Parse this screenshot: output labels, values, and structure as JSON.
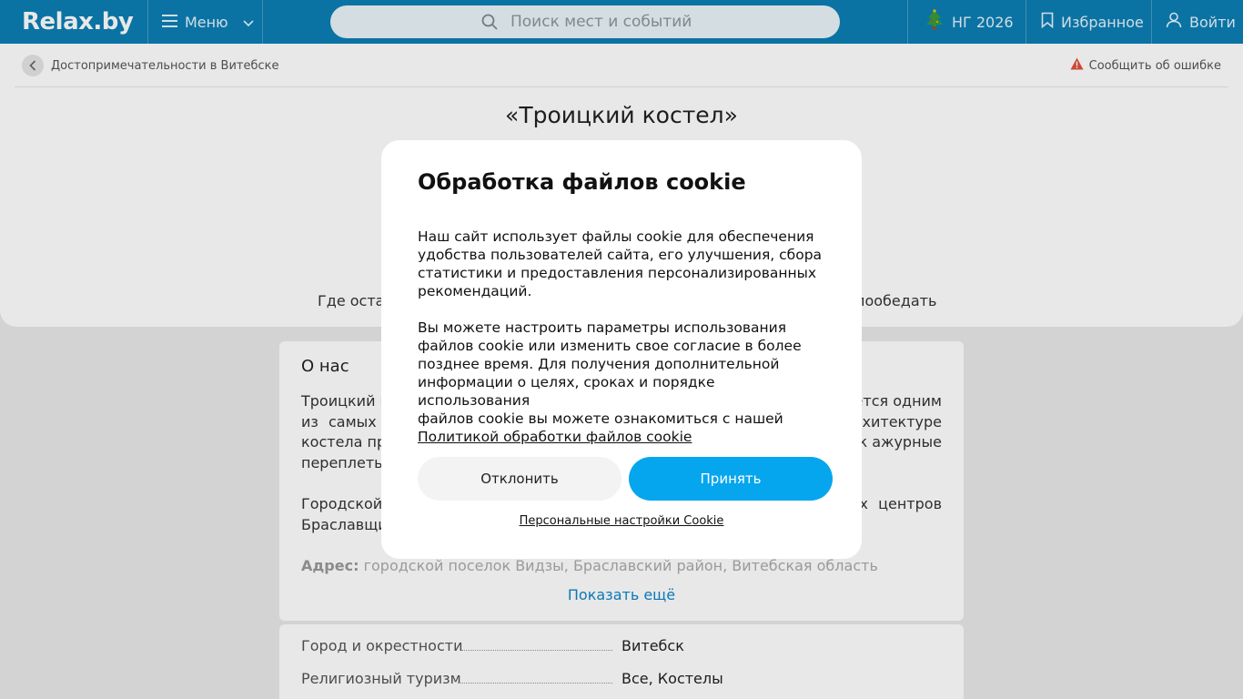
{
  "header": {
    "logo": "Relax.by",
    "menu_label": "Меню",
    "search_placeholder": "Поиск мест и событий",
    "ng_label": "НГ 2026",
    "favorites_label": "Избранное",
    "login_label": "Войти"
  },
  "breadcrumb": {
    "label": "Достопримечательности в Витебске",
    "report_label": "Сообщить об ошибке"
  },
  "page": {
    "title": "«Троицкий костел»",
    "tabs_left_fragment": "Где оста",
    "tabs_right_fragment": "пообедать"
  },
  "about": {
    "heading": "О нас",
    "line1_left": "Троицкий к",
    "line1_right": "ется одним",
    "line2_left": "из  самых",
    "line2_right": "рхитектуре",
    "line3_left": "костела пр",
    "line3_right": "к ажурные",
    "line4_left": "переплеты",
    "line5_left": "Городской",
    "line5_right": "х  центров",
    "line6_left": "Браславщи",
    "address_label": "Адрес:",
    "address_value": "городской поселок Видзы, Браславский район, Витебская область",
    "show_more": "Показать ещё"
  },
  "properties": [
    {
      "label": "Город и окрестности",
      "value": "Витебск"
    },
    {
      "label": "Религиозный туризм",
      "value": "Все, Костелы"
    }
  ],
  "cookie_modal": {
    "title": "Обработка файлов cookie",
    "para1": [
      "Наш сайт использует файлы cookie для обеспечения",
      "удобства пользователей сайта, его улучшения, сбора",
      "статистики и предоставления персонализированных",
      "рекомендаций."
    ],
    "para2": [
      "Вы можете настроить параметры использования",
      "файлов cookie или изменить свое согласие в более",
      "позднее время. Для получения дополнительной",
      "информации о целях, сроках и порядке использования",
      "файлов cookie вы можете ознакомиться с нашей"
    ],
    "policy_link": "Политикой обработки файлов cookie",
    "decline_label": "Отклонить",
    "accept_label": "Принять",
    "personal_settings_label": "Персональные настройки Cookie"
  },
  "colors": {
    "header_bg": "#0b7fb5",
    "accept_bg": "#06a6ee",
    "link": "#0b86c8",
    "warning": "#e2513a"
  }
}
